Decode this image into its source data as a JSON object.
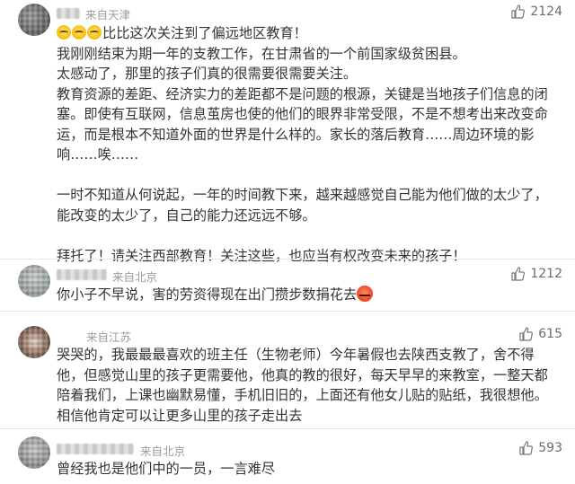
{
  "comments": [
    {
      "location": "来自天津",
      "likes": "2124",
      "lines": [
        "比比这次关注到了偏远地区教育！",
        "我刚刚结束为期一年的支教工作，在甘肃省的一个前国家级贫困县。",
        "太感动了，那里的孩子们真的很需要很需要关注。",
        "教育资源的差距、经济实力的差距都不是问题的根源，关键是当地孩子们信息的闭塞。即使有互联网，信息茧房也使的他们的眼界非常受限，不是不想考出来改变命运，而是根本不知道外面的世界是什么样的。家长的落后教育……周边环境的影响……唉……",
        "一时不知道从何说起，一年的时间教下来，越来越感觉自己能为他们做的太少了，能改变的太少了，自己的能力还远远不够。",
        "拜托了！请关注西部教育！关注这些，也应当有权改变未来的孩子！"
      ]
    },
    {
      "location": "来自北京",
      "likes": "1212",
      "text": "你小子不早说，害的劳资得现在出门攒步数捐花去"
    },
    {
      "location": "来自江苏",
      "likes": "615",
      "text": "哭哭的，我最最最喜欢的班主任（生物老师）今年暑假也去陕西支教了，舍不得他，但感觉山里的孩子更需要他，他真的教的很好，每天早早的来教室，一整天都陪着我们，上课也幽默易懂，手机旧旧的，上面还有他女儿贴的贴纸，我很想他。相信他肯定可以让更多山里的孩子走出去"
    },
    {
      "location": "来自北京",
      "likes": "593",
      "text": "曾经我也是他们中的一员，一言难尽"
    }
  ],
  "icons": {
    "like": "thumbs-up-icon",
    "emoji_cry": "crying-emoji",
    "emoji_angry": "angry-emoji"
  },
  "colors": {
    "text": "#333333",
    "meta": "#9b9b9b",
    "likes": "#6b6b6b"
  }
}
